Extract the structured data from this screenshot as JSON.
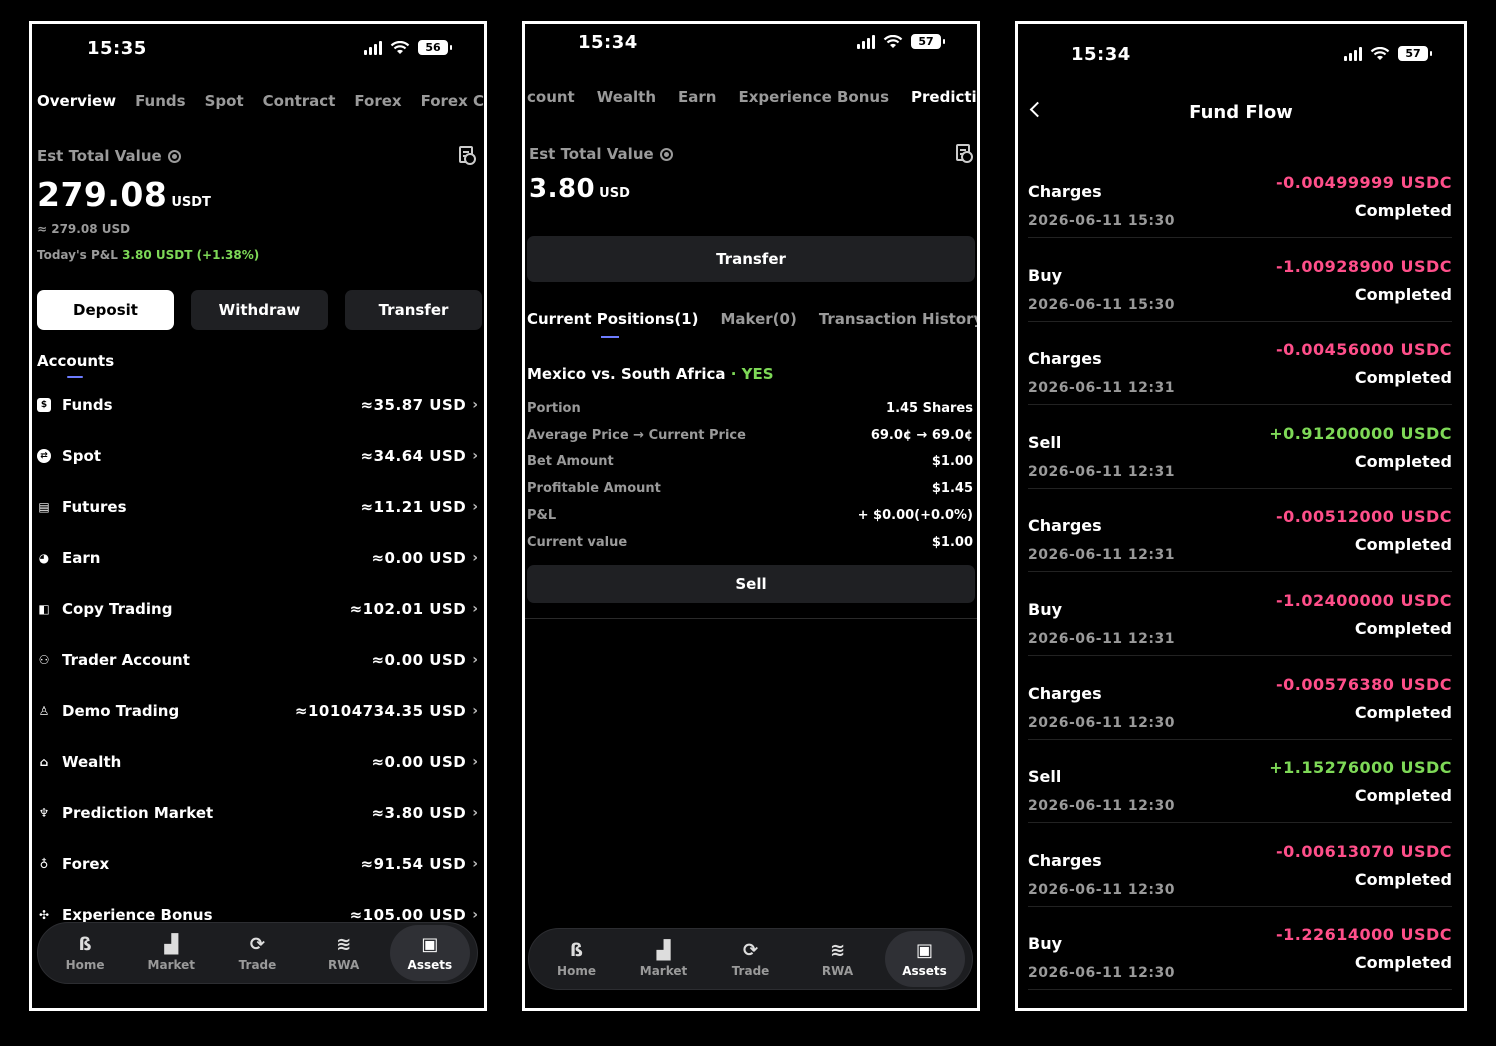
{
  "colors": {
    "accent": "#6d7cff",
    "positive": "#7ed957",
    "negative": "#ff4f8a",
    "muted": "#9a9a9a",
    "background": "#000000"
  },
  "nav": [
    {
      "label": "Home",
      "icon": "brand-b-icon"
    },
    {
      "label": "Market",
      "icon": "bar-chart-icon"
    },
    {
      "label": "Trade",
      "icon": "exchange-icon"
    },
    {
      "label": "RWA",
      "icon": "layers-icon"
    },
    {
      "label": "Assets",
      "icon": "wallet-icon"
    }
  ],
  "panel1": {
    "status": {
      "time": "15:35",
      "battery": "56"
    },
    "tabs": [
      "Overview",
      "Funds",
      "Spot",
      "Contract",
      "Forex",
      "Forex Co"
    ],
    "est_label": "Est Total Value",
    "total_value": "279.08",
    "total_unit": "USDT",
    "approx_usd": "≈ 279.08 USD",
    "pnl_label": "Today's P&L",
    "pnl_value": "3.80 USDT (+1.38%)",
    "buttons": {
      "deposit": "Deposit",
      "withdraw": "Withdraw",
      "transfer": "Transfer"
    },
    "accounts_title": "Accounts",
    "accounts": [
      {
        "name": "Funds",
        "value": "≈35.87 USD",
        "icon": "funds-icon"
      },
      {
        "name": "Spot",
        "value": "≈34.64 USD",
        "icon": "spot-icon"
      },
      {
        "name": "Futures",
        "value": "≈11.21 USD",
        "icon": "futures-icon"
      },
      {
        "name": "Earn",
        "value": "≈0.00 USD",
        "icon": "pie-icon"
      },
      {
        "name": "Copy Trading",
        "value": "≈102.01 USD",
        "icon": "copy-icon"
      },
      {
        "name": "Trader Account",
        "value": "≈0.00 USD",
        "icon": "users-icon"
      },
      {
        "name": "Demo Trading",
        "value": "≈10104734.35 USD",
        "icon": "demo-icon"
      },
      {
        "name": "Wealth",
        "value": "≈0.00 USD",
        "icon": "bank-icon"
      },
      {
        "name": "Prediction Market",
        "value": "≈3.80 USD",
        "icon": "trophy-icon"
      },
      {
        "name": "Forex",
        "value": "≈91.54 USD",
        "icon": "forex-icon"
      },
      {
        "name": "Experience Bonus",
        "value": "≈105.00 USD",
        "icon": "bonus-icon"
      }
    ]
  },
  "panel2": {
    "status": {
      "time": "15:34",
      "battery": "57"
    },
    "tabs": [
      "count",
      "Wealth",
      "Earn",
      "Experience Bonus",
      "Prediction"
    ],
    "est_label": "Est Total Value",
    "total_value": "3.80",
    "total_unit": "USD",
    "transfer": "Transfer",
    "subtabs": [
      "Current Positions(1)",
      "Maker(0)",
      "Transaction History"
    ],
    "event": "Mexico vs. South Africa",
    "event_side": "· YES",
    "details": [
      {
        "k": "Portion",
        "v": "1.45 Shares"
      },
      {
        "k": "Average Price → Current Price",
        "v": "69.0¢ → 69.0¢"
      },
      {
        "k": "Bet Amount",
        "v": "$1.00"
      },
      {
        "k": "Profitable Amount",
        "v": "$1.45"
      },
      {
        "k": "P&L",
        "v": "+ $0.00(+0.0%)"
      },
      {
        "k": "Current value",
        "v": "$1.00"
      }
    ],
    "sell": "Sell"
  },
  "panel3": {
    "status": {
      "time": "15:34",
      "battery": "57"
    },
    "title": "Fund Flow",
    "rows": [
      {
        "type": "Charges",
        "date": "2026-06-11 15:30",
        "amount": "-0.00499999 USDC",
        "status": "Completed",
        "sign": "neg"
      },
      {
        "type": "Buy",
        "date": "2026-06-11 15:30",
        "amount": "-1.00928900 USDC",
        "status": "Completed",
        "sign": "neg"
      },
      {
        "type": "Charges",
        "date": "2026-06-11 12:31",
        "amount": "-0.00456000 USDC",
        "status": "Completed",
        "sign": "neg"
      },
      {
        "type": "Sell",
        "date": "2026-06-11 12:31",
        "amount": "+0.91200000 USDC",
        "status": "Completed",
        "sign": "pos"
      },
      {
        "type": "Charges",
        "date": "2026-06-11 12:31",
        "amount": "-0.00512000 USDC",
        "status": "Completed",
        "sign": "neg"
      },
      {
        "type": "Buy",
        "date": "2026-06-11 12:31",
        "amount": "-1.02400000 USDC",
        "status": "Completed",
        "sign": "neg"
      },
      {
        "type": "Charges",
        "date": "2026-06-11 12:30",
        "amount": "-0.00576380 USDC",
        "status": "Completed",
        "sign": "neg"
      },
      {
        "type": "Sell",
        "date": "2026-06-11 12:30",
        "amount": "+1.15276000 USDC",
        "status": "Completed",
        "sign": "pos"
      },
      {
        "type": "Charges",
        "date": "2026-06-11 12:30",
        "amount": "-0.00613070 USDC",
        "status": "Completed",
        "sign": "neg"
      },
      {
        "type": "Buy",
        "date": "2026-06-11 12:30",
        "amount": "-1.22614000 USDC",
        "status": "Completed",
        "sign": "neg"
      }
    ]
  }
}
